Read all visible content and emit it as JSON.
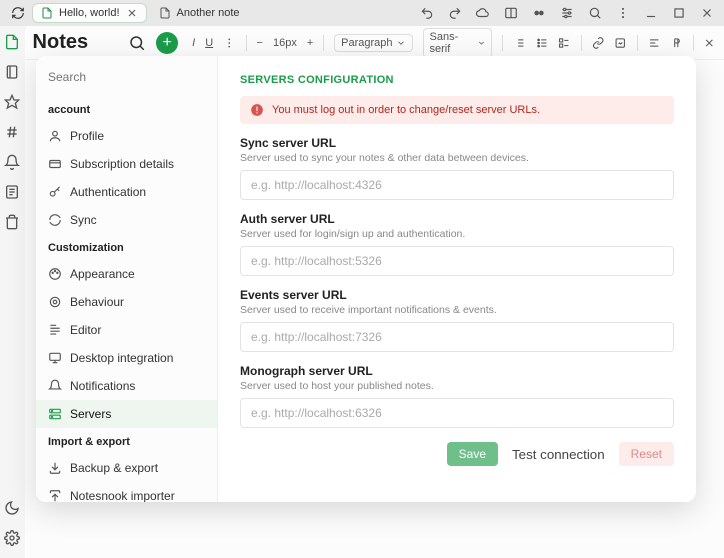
{
  "tabs": [
    {
      "label": "Hello, world!",
      "active": true
    },
    {
      "label": "Another note",
      "active": false
    }
  ],
  "app": {
    "notes_title": "Notes"
  },
  "toolbar": {
    "font_size": "16px",
    "block_style": "Paragraph",
    "font_family": "Sans-serif"
  },
  "settings": {
    "search_placeholder": "Search",
    "sections": {
      "account": "account",
      "customization": "Customization",
      "import_export": "Import & export"
    },
    "items": {
      "profile": "Profile",
      "subscription": "Subscription details",
      "authentication": "Authentication",
      "sync": "Sync",
      "appearance": "Appearance",
      "behaviour": "Behaviour",
      "editor": "Editor",
      "desktop": "Desktop integration",
      "notifications": "Notifications",
      "servers": "Servers",
      "backup": "Backup & export",
      "notesnook_importer": "Notesnook importer"
    }
  },
  "config": {
    "title": "SERVERS CONFIGURATION",
    "alert": "You must log out in order to change/reset server URLs.",
    "fields": [
      {
        "label": "Sync server URL",
        "help": "Server used to sync your notes & other data between devices.",
        "placeholder": "e.g. http://localhost:4326"
      },
      {
        "label": "Auth server URL",
        "help": "Server used for login/sign up and authentication.",
        "placeholder": "e.g. http://localhost:5326"
      },
      {
        "label": "Events server URL",
        "help": "Server used to receive important notifications & events.",
        "placeholder": "e.g. http://localhost:7326"
      },
      {
        "label": "Monograph server URL",
        "help": "Server used to host your published notes.",
        "placeholder": "e.g. http://localhost:6326"
      }
    ],
    "actions": {
      "save": "Save",
      "test": "Test connection",
      "reset": "Reset"
    }
  }
}
